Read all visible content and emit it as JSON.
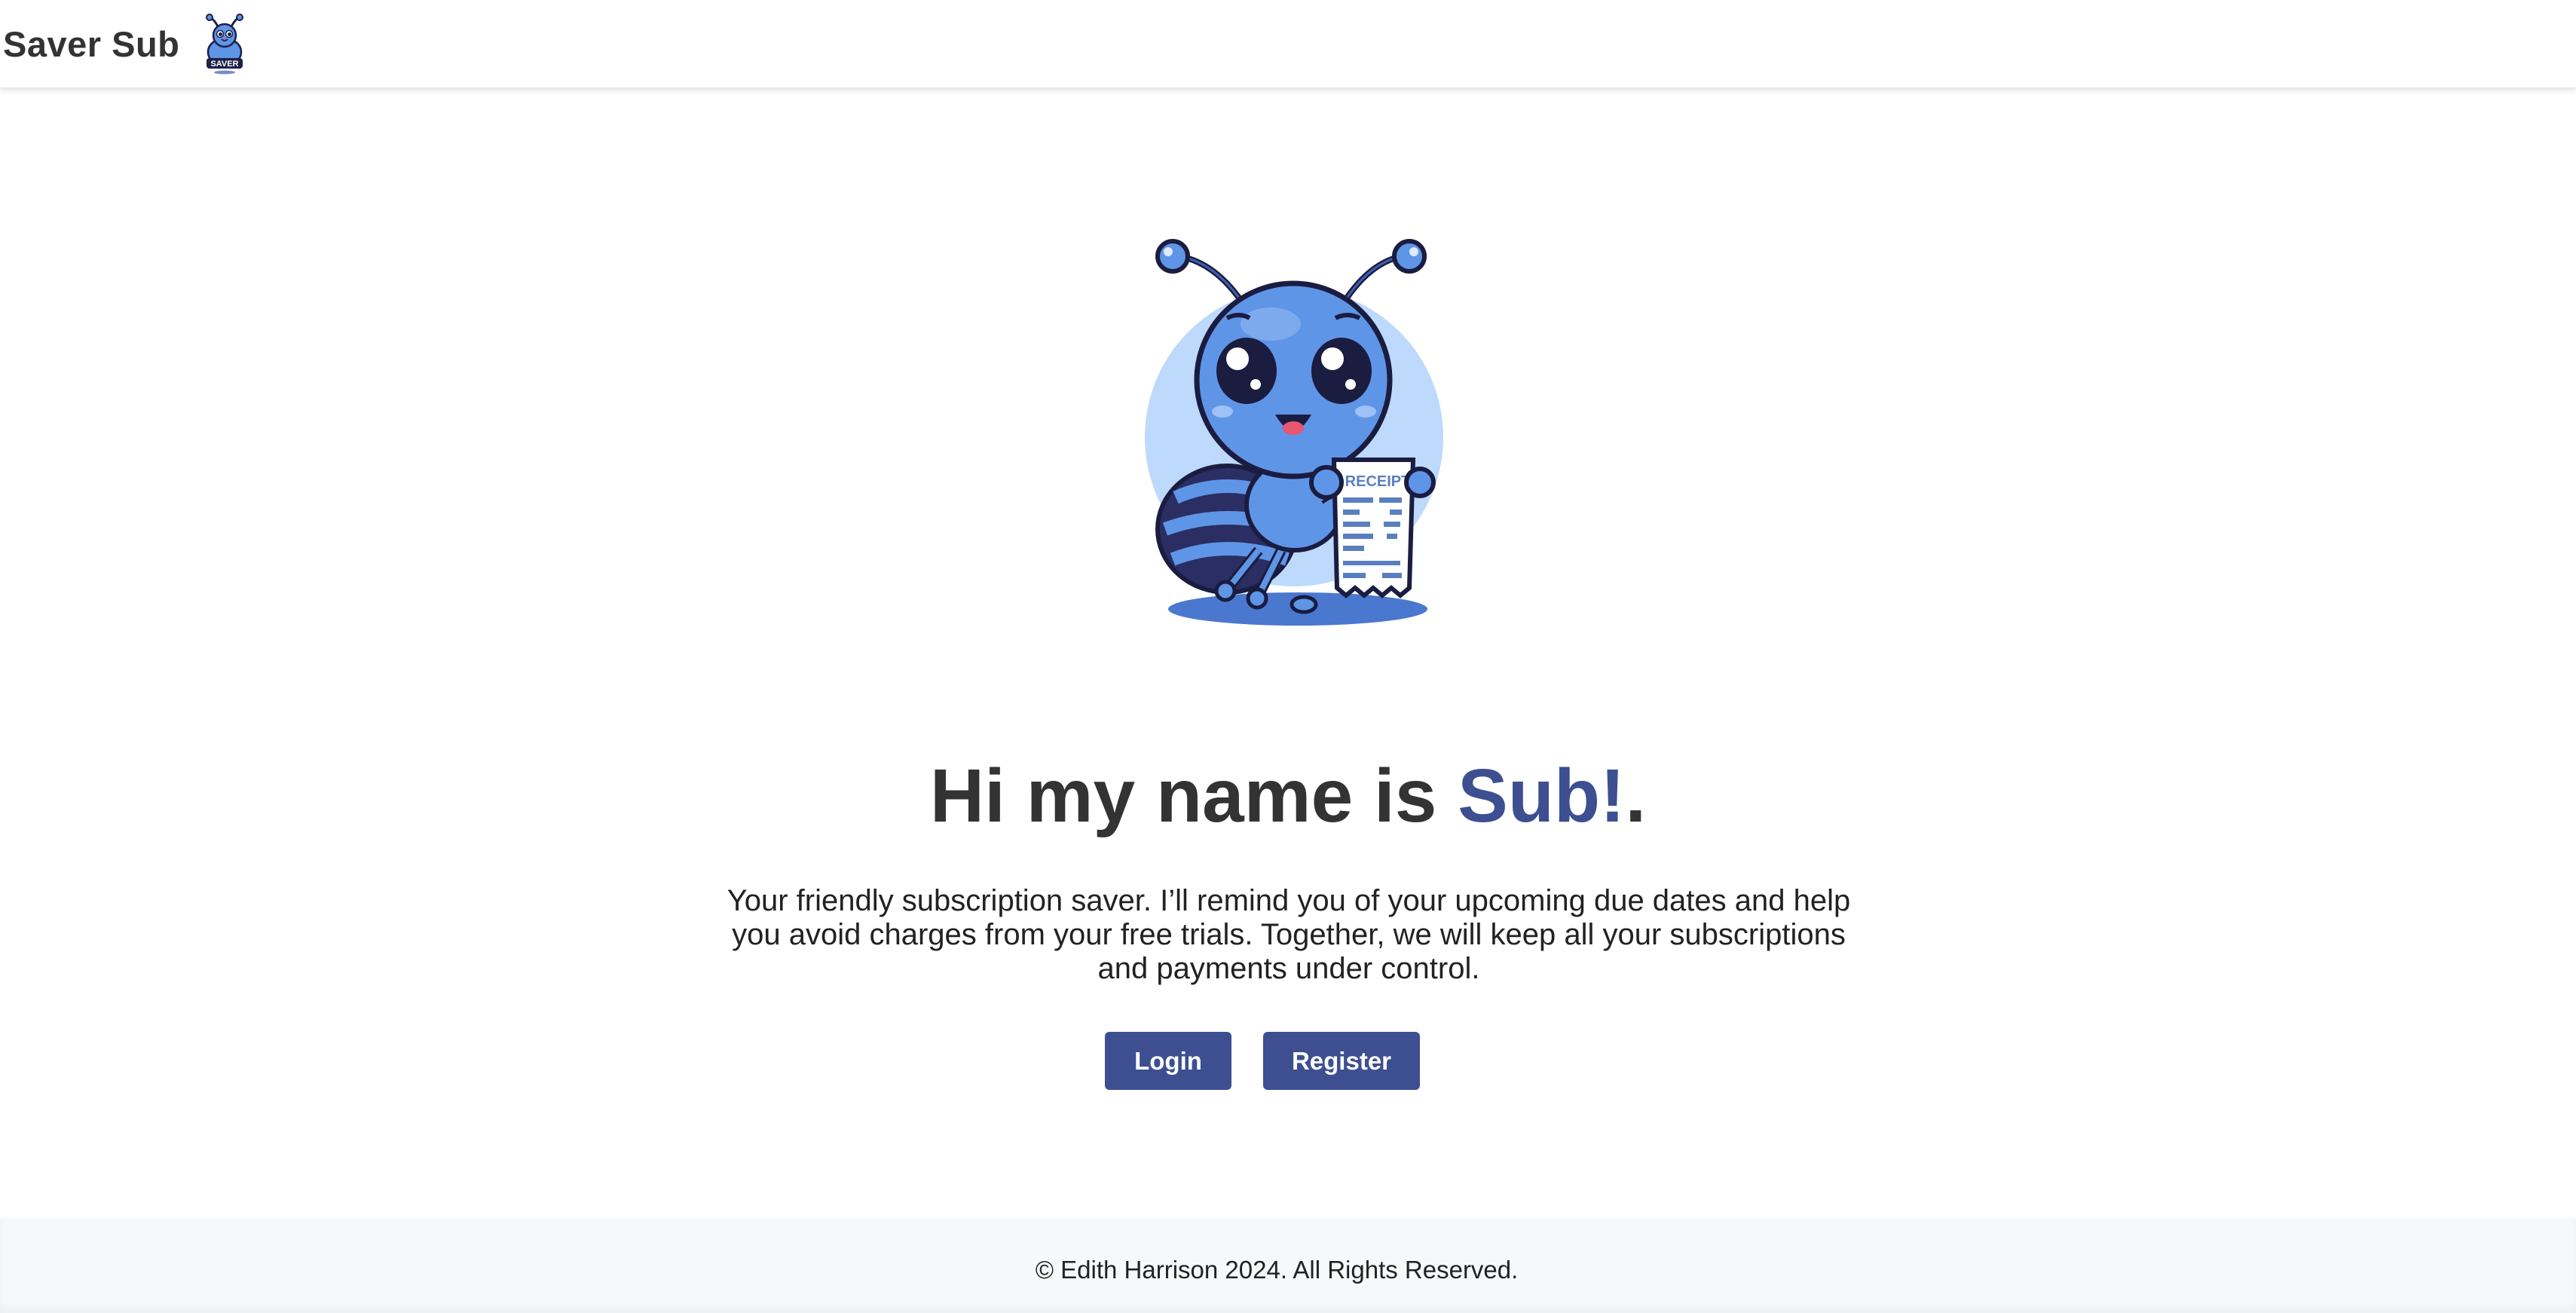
{
  "header": {
    "brand_name": "Saver Sub",
    "logo_text": "SAVER"
  },
  "hero": {
    "mascot_sign_text": "RECEIPT",
    "headline_prefix": "Hi my name is ",
    "headline_name": "Sub!",
    "headline_suffix": ".",
    "tagline": "Your friendly subscription saver. I’ll remind you of your upcoming due dates and help you avoid charges from your free trials. Together, we will keep all your subscriptions and payments under control."
  },
  "actions": {
    "login_label": "Login",
    "register_label": "Register"
  },
  "footer": {
    "copyright": "© Edith Harrison 2024. All Rights Reserved."
  },
  "colors": {
    "accent": "#3d4f91",
    "text": "#333333",
    "footer_bg": "#f7f8fa",
    "mascot_blue": "#5f95e6",
    "mascot_halo": "#bdd9fb"
  },
  "icons": {
    "brand_logo": "ant-mascot-logo-icon",
    "mascot": "ant-mascot-holding-receipt"
  }
}
